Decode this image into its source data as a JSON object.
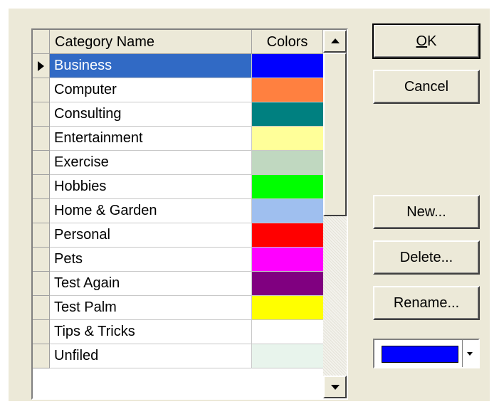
{
  "grid": {
    "headers": {
      "name": "Category Name",
      "colors": "Colors"
    },
    "selected_index": 0,
    "rows": [
      {
        "name": "Business",
        "color": "#0000ff"
      },
      {
        "name": "Computer",
        "color": "#ff8040"
      },
      {
        "name": "Consulting",
        "color": "#008080"
      },
      {
        "name": "Entertainment",
        "color": "#ffff99"
      },
      {
        "name": "Exercise",
        "color": "#c0d8c0"
      },
      {
        "name": "Hobbies",
        "color": "#00ff00"
      },
      {
        "name": "Home & Garden",
        "color": "#9fbfef"
      },
      {
        "name": "Personal",
        "color": "#ff0000"
      },
      {
        "name": "Pets",
        "color": "#ff00ff"
      },
      {
        "name": "Test Again",
        "color": "#800080"
      },
      {
        "name": "Test Palm",
        "color": "#ffff00"
      },
      {
        "name": "Tips & Tricks",
        "color": "#ffffff"
      },
      {
        "name": "Unfiled",
        "color": "#e8f4ec"
      }
    ]
  },
  "buttons": {
    "ok_label_mnemonic": "O",
    "ok_label_rest": "K",
    "cancel_label": "Cancel",
    "new_label": "New...",
    "delete_label": "Delete...",
    "rename_label": "Rename..."
  },
  "color_picker": {
    "selected_color": "#0000ff"
  }
}
